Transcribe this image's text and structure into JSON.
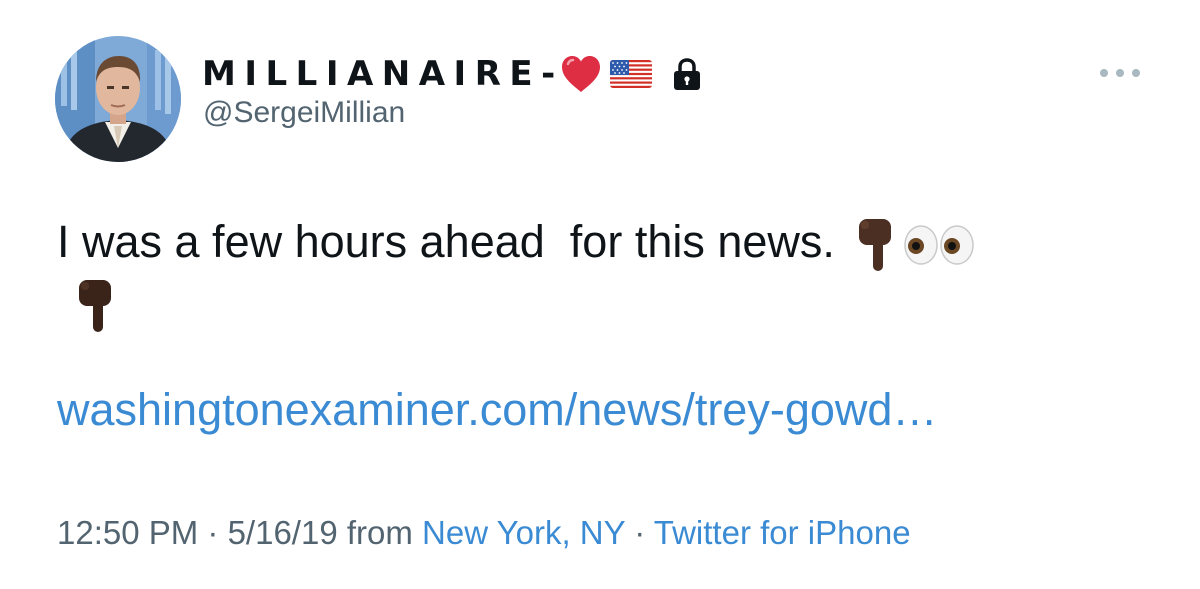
{
  "author": {
    "display_name": "MILLIANAIRE-",
    "handle": "@SergeiMillian",
    "badges": [
      "heart-icon",
      "us-flag-icon",
      "lock-icon"
    ]
  },
  "tweet": {
    "text": "I was a few hours ahead  for this news.",
    "emojis": [
      "pointing-down-icon",
      "eyes-icon",
      "pointing-down-icon"
    ],
    "link": "washingtonexaminer.com/news/trey-gowd…"
  },
  "meta": {
    "time": "12:50 PM",
    "sep1": " · ",
    "date": "5/16/19",
    "from_label": " from ",
    "location": "New York, NY",
    "sep2": " · ",
    "source": "Twitter for iPhone"
  },
  "colors": {
    "link": "#3a8bd3",
    "secondary_text": "#536471",
    "primary_text": "#0f1419"
  }
}
